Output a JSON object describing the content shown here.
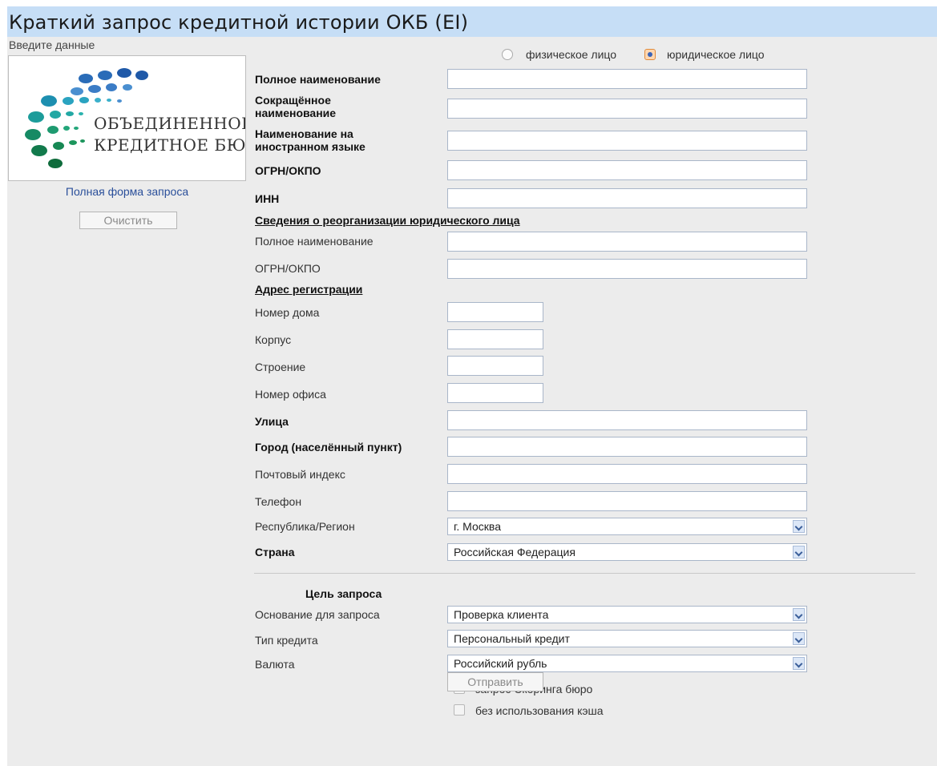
{
  "header": {
    "title": "Краткий запрос кредитной истории ОКБ (EI)",
    "subtitle": "Введите данные"
  },
  "sidebar": {
    "logo_line1": "ОБЪЕДИНЕННОЕ",
    "logo_line2": "КРЕДИТНОЕ БЮРО",
    "full_form_link": "Полная форма запроса",
    "clear_button": "Очистить"
  },
  "person_type": {
    "options": [
      "физическое лицо",
      "юридическое лицо"
    ],
    "selected": "юридическое лицо"
  },
  "company": {
    "full_name_label": "Полное наименование",
    "short_name_label": "Сокращённое\nнаименование",
    "foreign_name_label": "Наименование на\nиностранном языке",
    "ogrn_label": "ОГРН/ОКПО",
    "inn_label": "ИНН"
  },
  "reorganization": {
    "heading": "Сведения о реорганизации юридического лица",
    "full_name_label": "Полное наименование",
    "ogrn_label": "ОГРН/ОКПО"
  },
  "address": {
    "heading": "Адрес регистрации",
    "house_label": "Номер дома",
    "building_label": "Корпус",
    "structure_label": "Строение",
    "office_label": "Номер офиса",
    "street_label": "Улица",
    "city_label": "Город (населённый пункт)",
    "postcode_label": "Почтовый индекс",
    "phone_label": "Телефон",
    "region_label": "Республика/Регион",
    "region_value": "г. Москва",
    "country_label": "Страна",
    "country_value": "Российская Федерация"
  },
  "purpose": {
    "heading": "Цель запроса",
    "reason_label": "Основание для запроса",
    "reason_value": "Проверка клиента",
    "credit_type_label": "Тип кредита",
    "credit_type_value": "Персональный кредит",
    "currency_label": "Валюта",
    "currency_value": "Российский рубль",
    "scoring_checkbox": "запрос Скоринга бюро",
    "no_cache_checkbox": "без использования кэша",
    "scoring_checked": false,
    "no_cache_checked": false
  },
  "submit_button": "Отправить"
}
